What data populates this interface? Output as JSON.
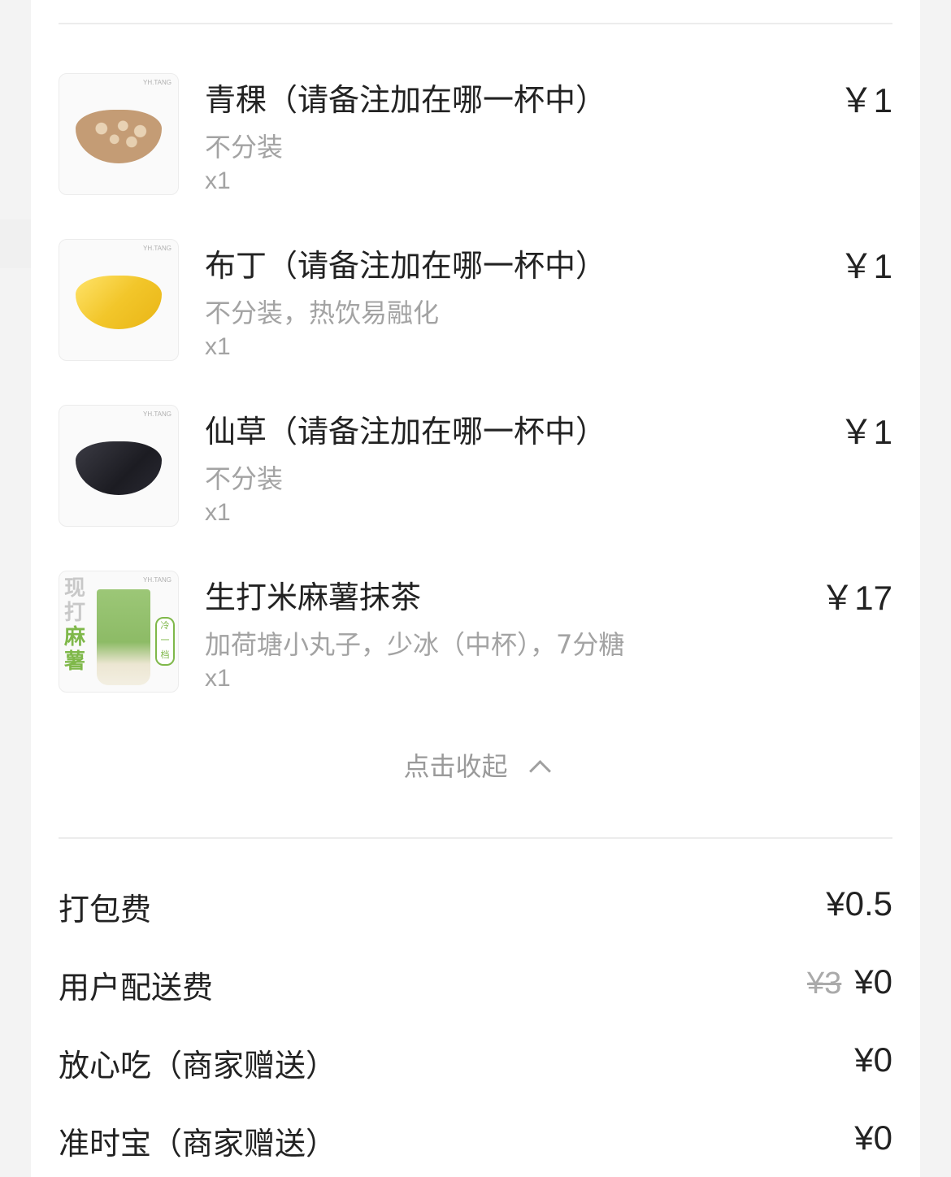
{
  "items": [
    {
      "name": "青稞（请备注加在哪一杯中）",
      "spec": "不分装",
      "qty": "x1",
      "price": "￥1",
      "thumb_brand": "YH.TANG",
      "thumb_color": "#c9a27a"
    },
    {
      "name": "布丁（请备注加在哪一杯中）",
      "spec": "不分装，热饮易融化",
      "qty": "x1",
      "price": "￥1",
      "thumb_brand": "YH.TANG",
      "thumb_color": "#f2cf3a"
    },
    {
      "name": "仙草（请备注加在哪一杯中）",
      "spec": "不分装",
      "qty": "x1",
      "price": "￥1",
      "thumb_brand": "YH.TANG",
      "thumb_color": "#2a2a30"
    },
    {
      "name": "生打米麻薯抹茶",
      "spec": "加荷塘小丸子，少冰（中杯），7分糖",
      "qty": "x1",
      "price": "￥17",
      "thumb_brand": "YH.TANG",
      "thumb_text": [
        "现",
        "打",
        "麻",
        "薯"
      ],
      "thumb_badge": "冷一档",
      "thumb_color": "#8fc06a"
    }
  ],
  "collapse_label": "点击收起",
  "fees": [
    {
      "label": "打包费",
      "value": "¥0.5"
    },
    {
      "label": "用户配送费",
      "original": "¥3",
      "value": "¥0"
    },
    {
      "label": "放心吃（商家赠送）",
      "value": "¥0"
    },
    {
      "label": "准时宝（商家赠送）",
      "value": "¥0"
    }
  ]
}
